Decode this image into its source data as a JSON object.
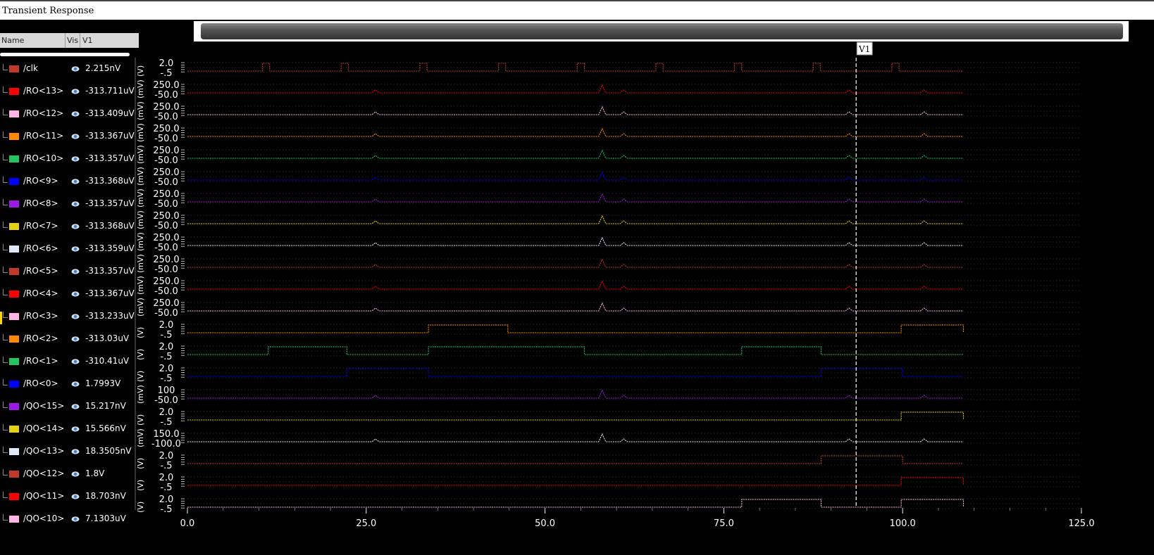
{
  "window": {
    "title": "Transient Response"
  },
  "columns": {
    "name": "Name",
    "vis": "Vis",
    "value": "V1"
  },
  "cursor": {
    "label": "V1",
    "x": 93.5
  },
  "signals": [
    {
      "name": "/clk",
      "value": "2.215nV",
      "color": "#c0392b",
      "ticks": [
        "2.0",
        "-.5"
      ],
      "unit": "(V)"
    },
    {
      "name": "/RO<13>",
      "value": "-313.711uV",
      "color": "#ff0000",
      "ticks": [
        "250.0",
        "-50.0"
      ],
      "unit": "(mV)"
    },
    {
      "name": "/RO<12>",
      "value": "-313.409uV",
      "color": "#ffb3e6",
      "ticks": [
        "250.0",
        "-50.0"
      ],
      "unit": "(mV)"
    },
    {
      "name": "/RO<11>",
      "value": "-313.367uV",
      "color": "#ff8800",
      "ticks": [
        "250.0",
        "-50.0"
      ],
      "unit": "(mV)"
    },
    {
      "name": "/RO<10>",
      "value": "-313.357uV",
      "color": "#22c55e",
      "ticks": [
        "250.0",
        "-50.0"
      ],
      "unit": "(mV)"
    },
    {
      "name": "/RO<9>",
      "value": "-313.368uV",
      "color": "#0000ff",
      "ticks": [
        "250.0",
        "-50.0"
      ],
      "unit": "(mV)"
    },
    {
      "name": "/RO<8>",
      "value": "-313.357uV",
      "color": "#9b1be3",
      "ticks": [
        "250.0",
        "-50.0"
      ],
      "unit": "(mV)"
    },
    {
      "name": "/RO<7>",
      "value": "-313.368uV",
      "color": "#e6d012",
      "ticks": [
        "250.0",
        "-50.0"
      ],
      "unit": "(mV)"
    },
    {
      "name": "/RO<6>",
      "value": "-313.359uV",
      "color": "#dfe8f8",
      "ticks": [
        "250.0",
        "-50.0"
      ],
      "unit": "(mV)"
    },
    {
      "name": "/RO<5>",
      "value": "-313.357uV",
      "color": "#c0392b",
      "ticks": [
        "250.0",
        "-50.0"
      ],
      "unit": "(mV)"
    },
    {
      "name": "/RO<4>",
      "value": "-313.367uV",
      "color": "#ff0000",
      "ticks": [
        "250.0",
        "-50.0"
      ],
      "unit": "(mV)"
    },
    {
      "name": "/RO<3>",
      "value": "-313.233uV",
      "color": "#ffb3e6",
      "ticks": [
        "250.0",
        "-50.0"
      ],
      "unit": "(mV)"
    },
    {
      "name": "/RO<2>",
      "value": "-313.03uV",
      "color": "#ff8800",
      "ticks": [
        "2.0",
        "-.5"
      ],
      "unit": "(V)"
    },
    {
      "name": "/RO<1>",
      "value": "-310.41uV",
      "color": "#22c55e",
      "ticks": [
        "2.0",
        "-.5"
      ],
      "unit": "(V)"
    },
    {
      "name": "/RO<0>",
      "value": "1.7993V",
      "color": "#0000ff",
      "ticks": [
        "2.0",
        "-.5"
      ],
      "unit": "(V)"
    },
    {
      "name": "/QO<15>",
      "value": "15.217nV",
      "color": "#9b1be3",
      "ticks": [
        "100",
        "-50.0"
      ],
      "unit": "(mV)"
    },
    {
      "name": "/QO<14>",
      "value": "15.566nV",
      "color": "#e6d012",
      "ticks": [
        "2.0",
        "-.5"
      ],
      "unit": "(V)"
    },
    {
      "name": "/QO<13>",
      "value": "18.3505nV",
      "color": "#dfe8f8",
      "ticks": [
        "150.0",
        "-100.0"
      ],
      "unit": "(mV)"
    },
    {
      "name": "/QO<12>",
      "value": "1.8V",
      "color": "#c0392b",
      "ticks": [
        "2.0",
        "-.5"
      ],
      "unit": "(V)"
    },
    {
      "name": "/QO<11>",
      "value": "18.703nV",
      "color": "#ff0000",
      "ticks": [
        "2.0",
        "-.5"
      ],
      "unit": "(V)"
    },
    {
      "name": "/QO<10>",
      "value": "7.1303uV",
      "color": "#ffb3e6",
      "ticks": [
        "2.0",
        "-.5"
      ],
      "unit": "(V)"
    }
  ],
  "chart_data": {
    "type": "line",
    "x_ticks": [
      "0.0",
      "25.0",
      "50.0",
      "75.0",
      "100.0",
      "125.0"
    ],
    "xlim": [
      0,
      125
    ],
    "traces_end": 108.5,
    "series_shape": {
      "/clk": {
        "kind": "pulses",
        "edges": [
          [
            10.5,
            11.5
          ],
          [
            21.5,
            22.5
          ],
          [
            32.5,
            33.5
          ],
          [
            43.5,
            44.5
          ],
          [
            54.5,
            55.5
          ],
          [
            65.5,
            66.5
          ],
          [
            76.5,
            77.5
          ],
          [
            87.5,
            88.5
          ],
          [
            98.5,
            99.5
          ]
        ]
      },
      "/RO<2>": {
        "kind": "digital",
        "high": [
          [
            33.7,
            44.8
          ],
          [
            99.8,
            108.5
          ]
        ]
      },
      "/RO<1>": {
        "kind": "digital",
        "high": [
          [
            11.3,
            22.3
          ],
          [
            33.7,
            55.5
          ],
          [
            77.5,
            88.6
          ]
        ]
      },
      "/RO<0>": {
        "kind": "digital",
        "high": [
          [
            22.3,
            33.7
          ],
          [
            88.6,
            100
          ]
        ]
      },
      "/QO<14>": {
        "kind": "digital",
        "high": [
          [
            99.8,
            108.5
          ]
        ]
      },
      "/QO<12>": {
        "kind": "digital",
        "high": [
          [
            88.6,
            100
          ]
        ]
      },
      "/QO<11>": {
        "kind": "digital",
        "high": [
          [
            99.8,
            108.5
          ]
        ]
      },
      "/QO<10>": {
        "kind": "digital",
        "high": [
          [
            77.5,
            88.6
          ],
          [
            99.8,
            108.5
          ]
        ]
      },
      "spike_times": [
        26.3,
        58,
        61,
        92.5,
        103
      ]
    }
  }
}
